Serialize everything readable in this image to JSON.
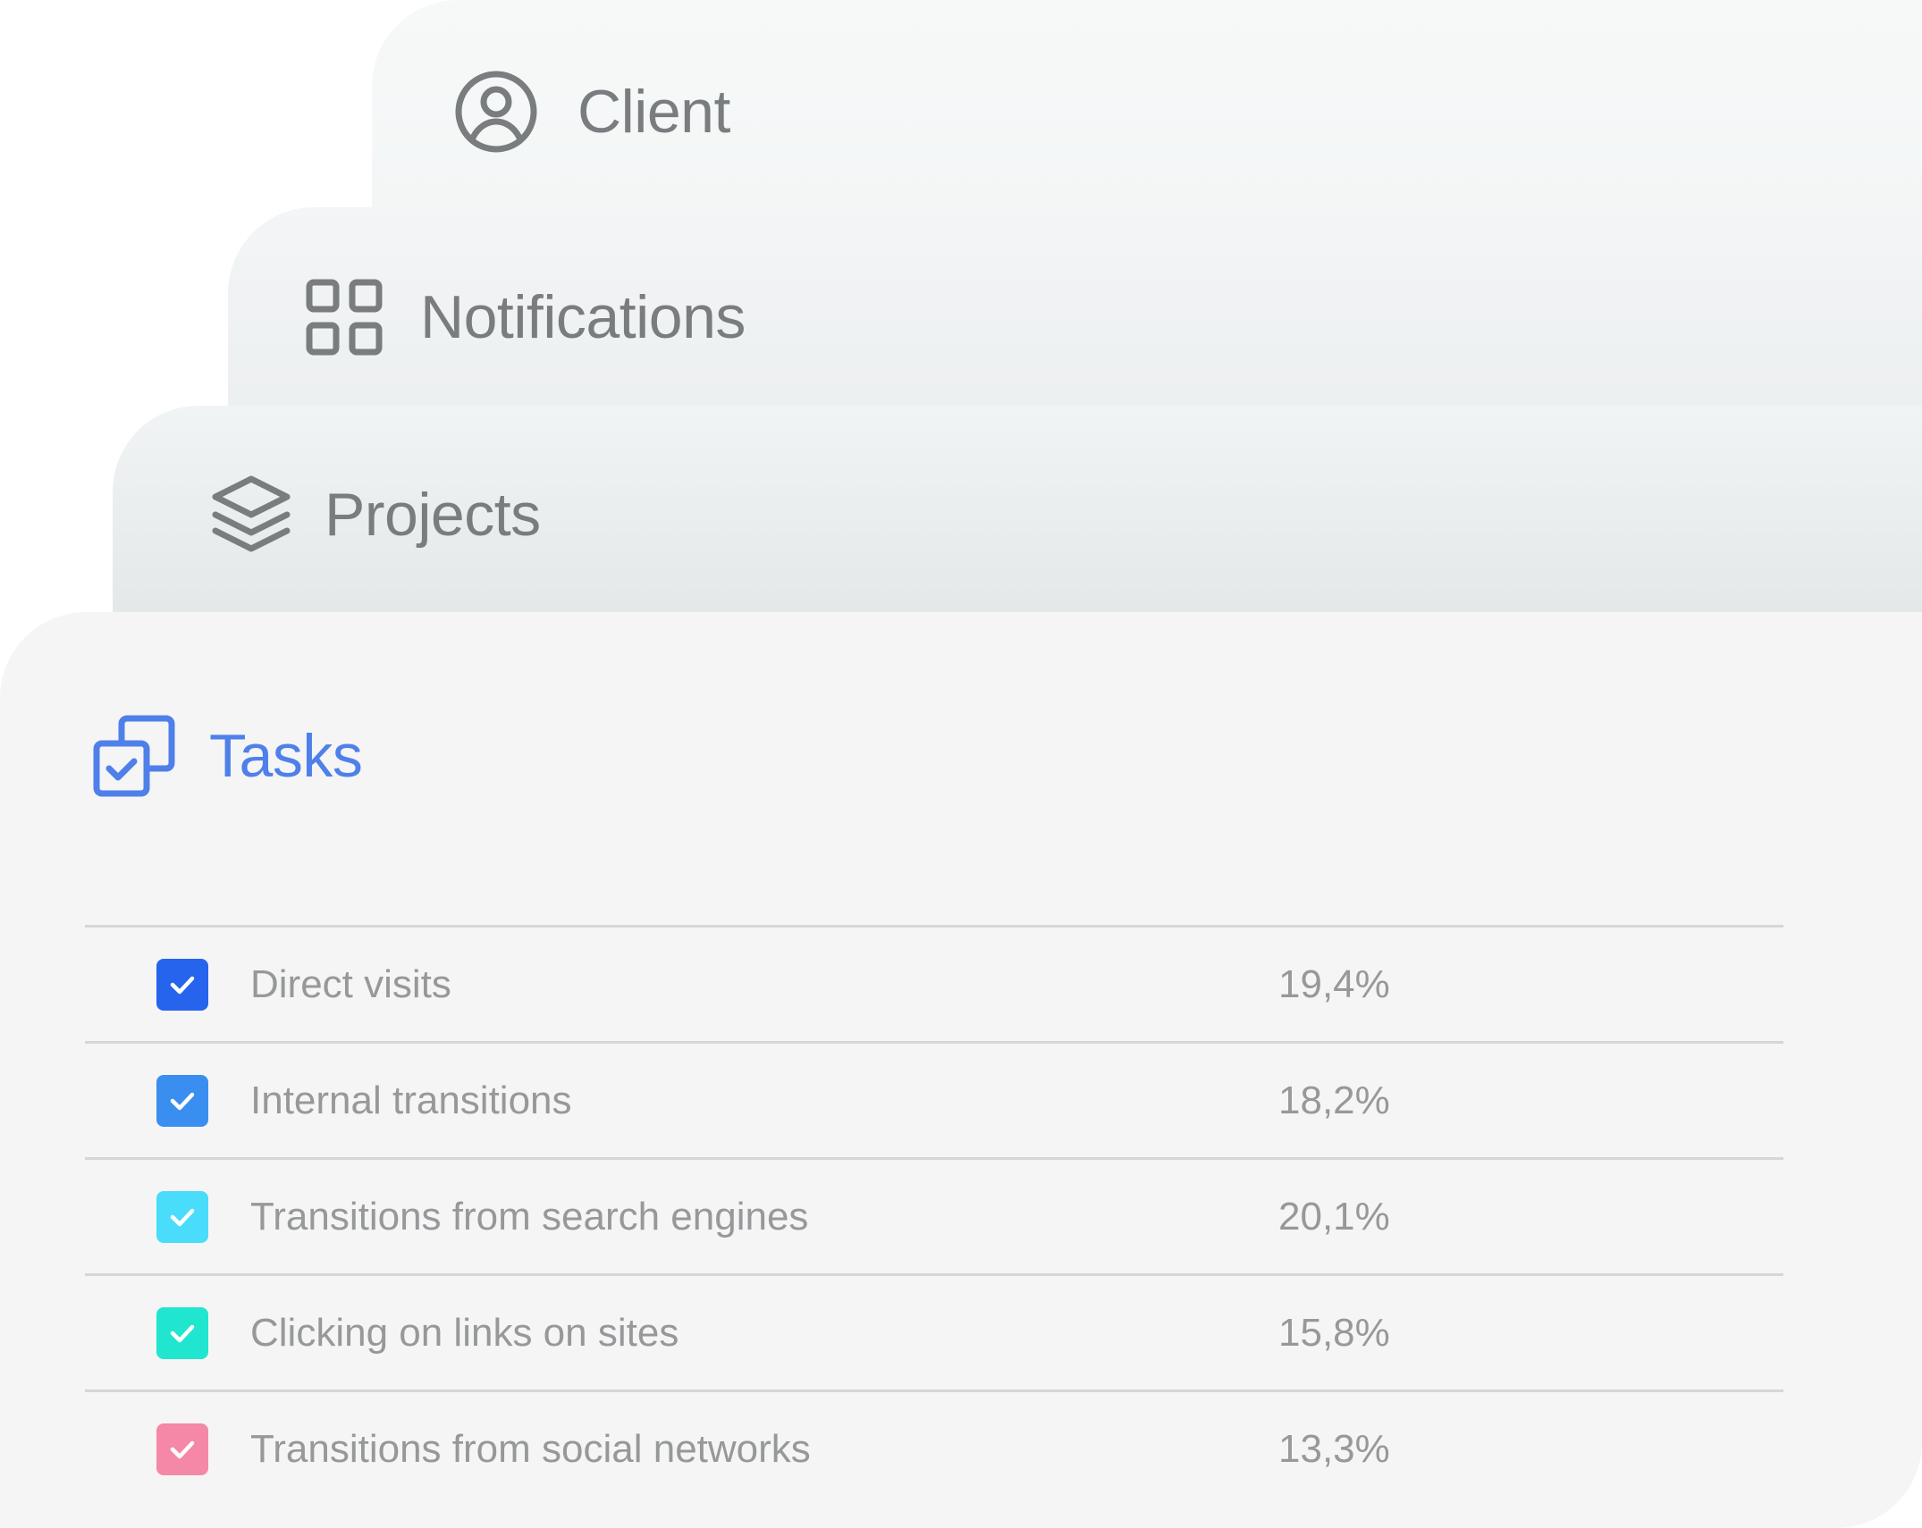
{
  "tabs": {
    "client": {
      "label": "Client",
      "icon": "user-circle-icon"
    },
    "notifications": {
      "label": "Notifications",
      "icon": "grid-icon"
    },
    "projects": {
      "label": "Projects",
      "icon": "layers-icon"
    },
    "tasks": {
      "label": "Tasks",
      "icon": "copy-check-icon",
      "active": true,
      "accent": "#4f80ea"
    }
  },
  "rows": [
    {
      "label": "Direct visits",
      "value": "19,4%",
      "checked": true,
      "color": "#2664ee"
    },
    {
      "label": "Internal transitions",
      "value": "18,2%",
      "checked": true,
      "color": "#3a8ef0"
    },
    {
      "label": "Transitions from search engines",
      "value": "20,1%",
      "checked": true,
      "color": "#49dcfb"
    },
    {
      "label": "Clicking on links on sites",
      "value": "15,8%",
      "checked": true,
      "color": "#20e6cf"
    },
    {
      "label": "Transitions from social networks",
      "value": "13,3%",
      "checked": true,
      "color": "#f588a6"
    }
  ]
}
